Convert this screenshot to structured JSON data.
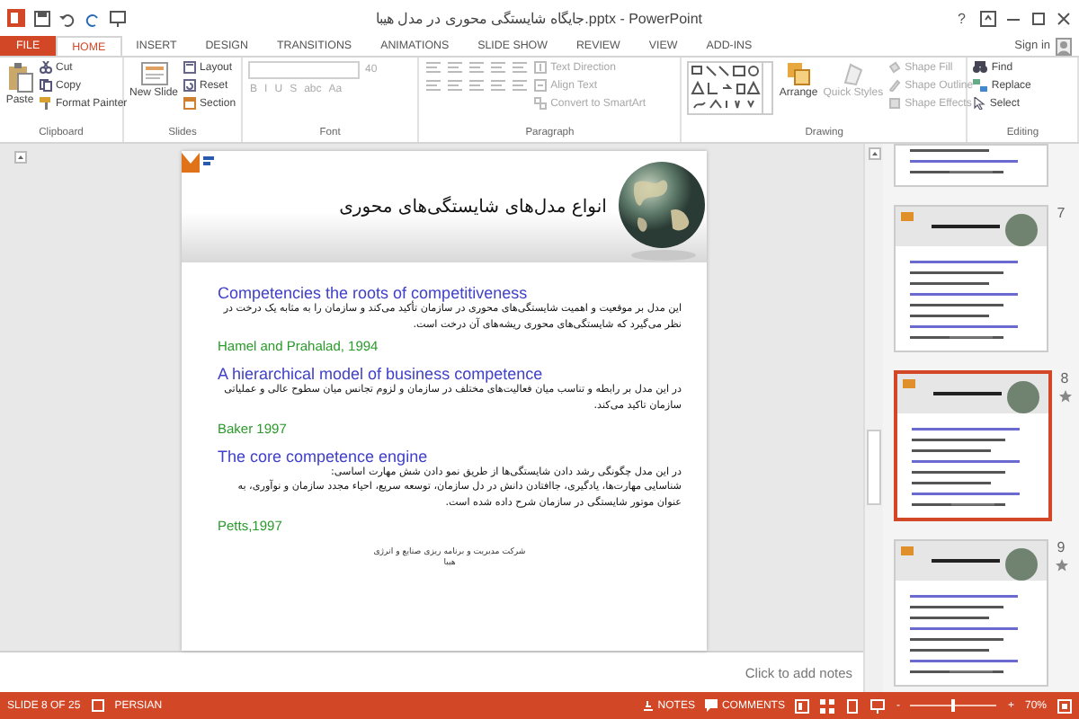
{
  "window": {
    "title": "جایگاه شایستگی محوری در مدل هیبا.pptx - PowerPoint",
    "help": "?"
  },
  "tabs": [
    {
      "label": "FILE",
      "kind": "file",
      "selected": false
    },
    {
      "label": "HOME",
      "kind": "tab",
      "selected": true
    },
    {
      "label": "INSERT",
      "kind": "tab",
      "selected": false
    },
    {
      "label": "DESIGN",
      "kind": "tab",
      "selected": false
    },
    {
      "label": "TRANSITIONS",
      "kind": "tab",
      "selected": false
    },
    {
      "label": "ANIMATIONS",
      "kind": "tab",
      "selected": false
    },
    {
      "label": "SLIDE SHOW",
      "kind": "tab",
      "selected": false
    },
    {
      "label": "REVIEW",
      "kind": "tab",
      "selected": false
    },
    {
      "label": "VIEW",
      "kind": "tab",
      "selected": false
    },
    {
      "label": "ADD-INS",
      "kind": "tab",
      "selected": false
    }
  ],
  "sign_in": "Sign in",
  "ribbon": [
    {
      "label": "Clipboard",
      "kind": "clipboard",
      "items": [
        {
          "label": "Paste",
          "disabled": false
        },
        {
          "label": "Cut",
          "disabled": false
        },
        {
          "label": "Copy",
          "disabled": false
        },
        {
          "label": "Format Painter",
          "disabled": false
        }
      ]
    },
    {
      "label": "Slides",
      "kind": "slides",
      "items": [
        {
          "label": "New Slide",
          "disabled": false
        },
        {
          "label": "Layout",
          "disabled": false
        },
        {
          "label": "Reset",
          "disabled": false
        },
        {
          "label": "Section",
          "disabled": false
        }
      ]
    },
    {
      "label": "Font",
      "kind": "font",
      "items": [
        {
          "label": "40",
          "disabled": true
        },
        {
          "label": "B",
          "disabled": true
        },
        {
          "label": "I",
          "disabled": true
        },
        {
          "label": "U",
          "disabled": true
        },
        {
          "label": "S",
          "disabled": true
        },
        {
          "label": "abc",
          "disabled": true
        },
        {
          "label": "Aa",
          "disabled": true
        }
      ]
    },
    {
      "label": "Paragraph",
      "kind": "paragraph",
      "items": [
        {
          "label": "Text Direction",
          "disabled": true
        },
        {
          "label": "Align Text",
          "disabled": true
        },
        {
          "label": "Convert to SmartArt",
          "disabled": true
        }
      ]
    },
    {
      "label": "Drawing",
      "kind": "drawing",
      "items": [
        {
          "label": "Arrange",
          "disabled": false
        },
        {
          "label": "Quick Styles",
          "disabled": true
        },
        {
          "label": "Shape Fill",
          "disabled": true
        },
        {
          "label": "Shape Outline",
          "disabled": true
        },
        {
          "label": "Shape Effects",
          "disabled": true
        }
      ]
    },
    {
      "label": "Editing",
      "kind": "editing",
      "items": [
        {
          "label": "Find",
          "disabled": false
        },
        {
          "label": "Replace",
          "disabled": false
        },
        {
          "label": "Select",
          "disabled": false
        }
      ]
    }
  ],
  "slide": {
    "title": "انواع مدل‌های شایستگی‌های محوری",
    "sections": [
      {
        "heading": "Competencies the roots of competitiveness",
        "body": [
          "این مدل بر موقعیت و اهمیت شایستگی‌های محوری در سازمان تأکید می‌کند و سازمان را به مثابه یک درخت در نظر می‌گیرد که شایستگی‌های محوری ریشه‌های آن درخت است."
        ],
        "citation": "Hamel and Prahalad, 1994"
      },
      {
        "heading": "A hierarchical model of business competence",
        "body": [
          "در این مدل بر رابطه و تناسب میان فعالیت‌های مختلف در سازمان و لزوم تجانس میان سطوح عالی و عملیاتی سازمان تاکید می‌کند."
        ],
        "citation": "Baker 1997"
      },
      {
        "heading": "The core competence engine",
        "body": [
          "در این مدل چگونگی رشد دادن شایستگی‌ها از طریق نمو دادن شش مهارت اساسی:",
          "شناسایی مهارت‌ها، یادگیری، جاافتادن دانش در دل سازمان، توسعه سریع، احیاء مجدد سازمان و نوآوری، به عنوان موتور شایستگی در سازمان شرح داده شده است."
        ],
        "citation": "Petts,1997"
      }
    ],
    "footer": [
      "شرکت مدیریت و برنامه ریزی صنایع و انرژی",
      "هیبا"
    ]
  },
  "notes_placeholder": "Click to add notes",
  "thumbnails": [
    {
      "selected": false
    },
    {
      "number": "7",
      "selected": false,
      "animated": false
    },
    {
      "number": "8",
      "selected": true,
      "animated": true
    },
    {
      "number": "9",
      "selected": false,
      "animated": true
    }
  ],
  "status_bar": {
    "slide": "SLIDE 8 OF 25",
    "language": "PERSIAN",
    "notes": "NOTES",
    "comments": "COMMENTS",
    "zoom_out": "-",
    "zoom_in": "+",
    "zoom": {
      "level": 0.5
    },
    "zoom_label": "70%"
  }
}
